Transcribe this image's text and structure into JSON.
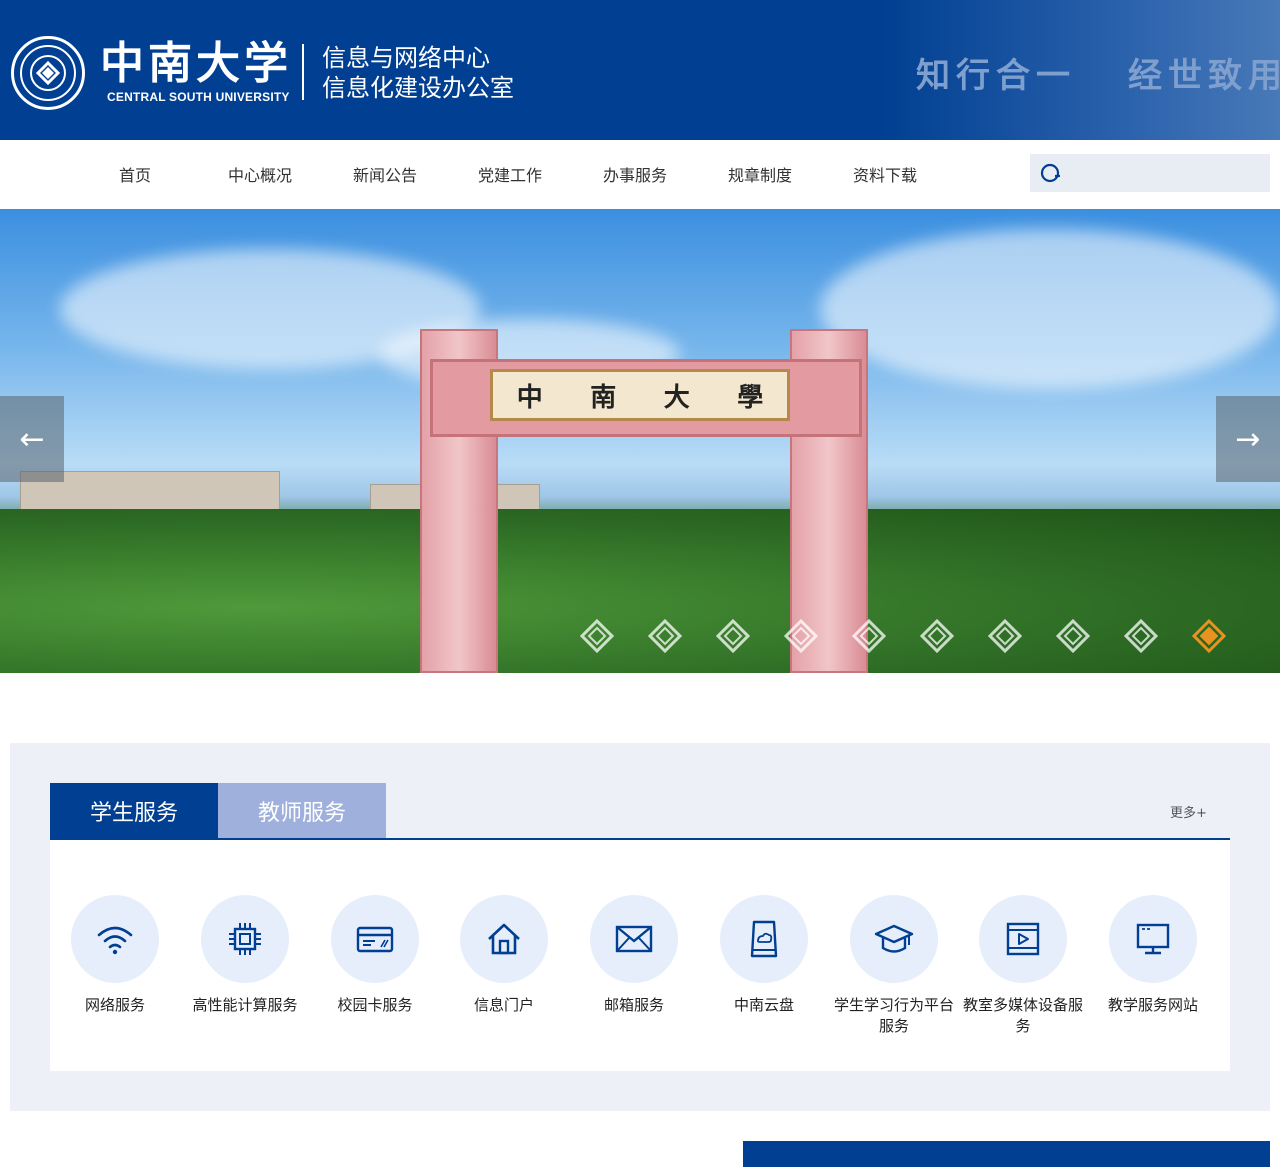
{
  "header": {
    "logo_cn": "中南大学",
    "logo_en": "CENTRAL SOUTH UNIVERSITY",
    "dept_line1": "信息与网络中心",
    "dept_line2": "信息化建设办公室",
    "motto_1": "知行合一",
    "motto_2": "经世致用"
  },
  "nav": {
    "items": [
      {
        "label": "首页"
      },
      {
        "label": "中心概况"
      },
      {
        "label": "新闻公告"
      },
      {
        "label": "党建工作"
      },
      {
        "label": "办事服务"
      },
      {
        "label": "规章制度"
      },
      {
        "label": "资料下载"
      }
    ],
    "search": {
      "icon": "search-icon",
      "placeholder": ""
    }
  },
  "banner": {
    "gate_text": [
      "中",
      "南",
      "大",
      "學"
    ],
    "prev_arrow": "←",
    "next_arrow": "→",
    "slide_count": 10,
    "active_slide": 9
  },
  "services": {
    "tabs": [
      {
        "label": "学生服务",
        "active": true
      },
      {
        "label": "教师服务",
        "active": false
      }
    ],
    "more": "更多+",
    "items": [
      {
        "label": "网络服务",
        "icon": "wifi-icon"
      },
      {
        "label": "高性能计算服务",
        "icon": "chip-icon"
      },
      {
        "label": "校园卡服务",
        "icon": "card-icon"
      },
      {
        "label": "信息门户",
        "icon": "home-icon"
      },
      {
        "label": "邮箱服务",
        "icon": "mail-icon"
      },
      {
        "label": "中南云盘",
        "icon": "cloud-drive-icon"
      },
      {
        "label": "学生学习行为平台服务",
        "icon": "graduation-cap-icon"
      },
      {
        "label": "教室多媒体设备服务",
        "icon": "video-play-icon"
      },
      {
        "label": "教学服务网站",
        "icon": "monitor-icon"
      }
    ]
  },
  "colors": {
    "brand_blue": "#003f91",
    "tab_inactive": "#9fb0dc",
    "icon_bg": "#e6eefb",
    "panel_bg": "#eef0f8",
    "slide_dot_active": "#e8921f"
  }
}
